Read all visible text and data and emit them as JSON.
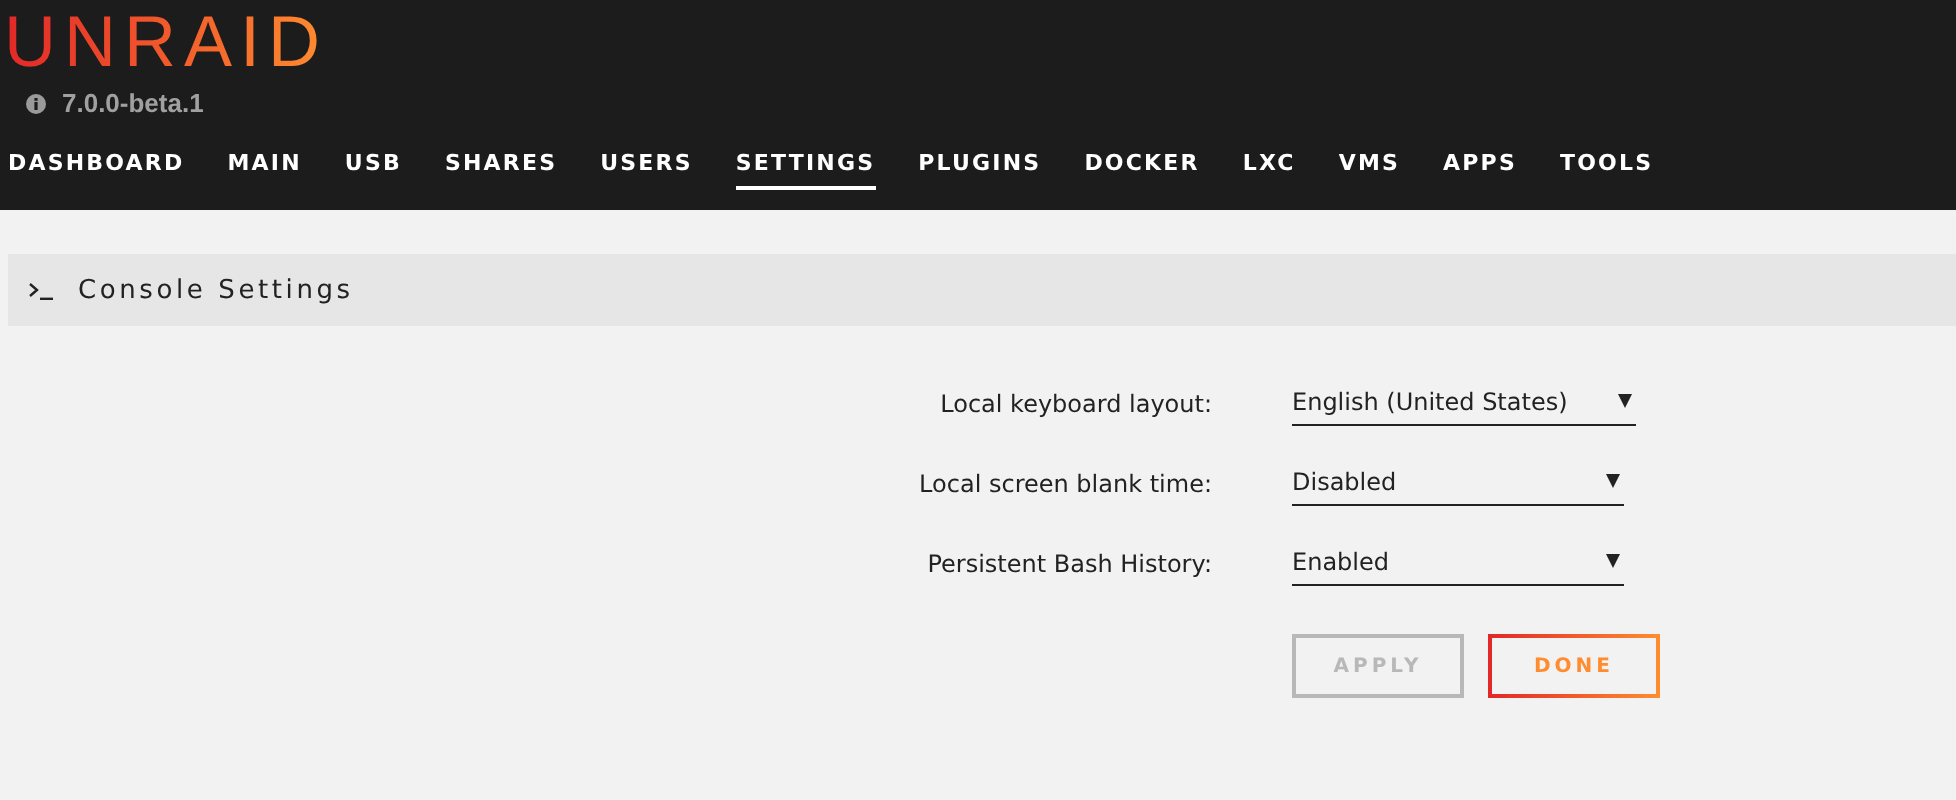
{
  "header": {
    "logo": "UNRAID",
    "version": "7.0.0-beta.1"
  },
  "nav": [
    {
      "label": "DASHBOARD",
      "selected": false
    },
    {
      "label": "MAIN",
      "selected": false
    },
    {
      "label": "USB",
      "selected": false
    },
    {
      "label": "SHARES",
      "selected": false
    },
    {
      "label": "USERS",
      "selected": false
    },
    {
      "label": "SETTINGS",
      "selected": true
    },
    {
      "label": "PLUGINS",
      "selected": false
    },
    {
      "label": "DOCKER",
      "selected": false
    },
    {
      "label": "LXC",
      "selected": false
    },
    {
      "label": "VMS",
      "selected": false
    },
    {
      "label": "APPS",
      "selected": false
    },
    {
      "label": "TOOLS",
      "selected": false
    }
  ],
  "section": {
    "title": "Console Settings"
  },
  "fields": [
    {
      "label": "Local keyboard layout:",
      "value": "English (United States)"
    },
    {
      "label": "Local screen blank time:",
      "value": "Disabled"
    },
    {
      "label": "Persistent Bash History:",
      "value": "Enabled"
    }
  ],
  "buttons": [
    {
      "label": "APPLY",
      "disabled": true
    },
    {
      "label": "DONE",
      "disabled": false
    }
  ]
}
